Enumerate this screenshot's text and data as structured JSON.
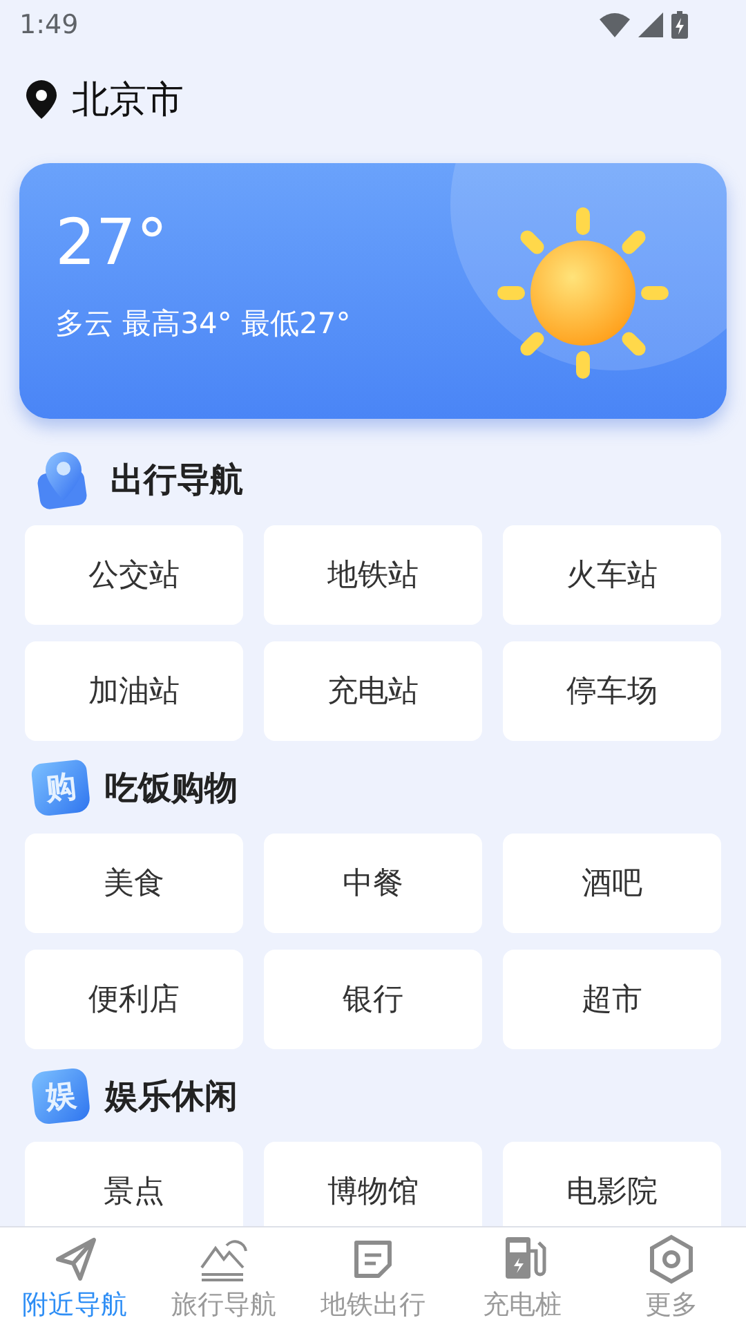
{
  "status_bar": {
    "time": "1:49"
  },
  "location": {
    "city": "北京市"
  },
  "weather": {
    "temperature": "27°",
    "summary": "多云 最高34° 最低27°"
  },
  "sections": [
    {
      "title": "出行导航",
      "items": [
        "公交站",
        "地铁站",
        "火车站",
        "加油站",
        "充电站",
        "停车场"
      ]
    },
    {
      "title": "吃饭购物",
      "icon_text": "购",
      "items": [
        "美食",
        "中餐",
        "酒吧",
        "便利店",
        "银行",
        "超市"
      ]
    },
    {
      "title": "娱乐休闲",
      "icon_text": "娱",
      "items": [
        "景点",
        "博物馆",
        "电影院"
      ]
    }
  ],
  "tab_bar": [
    {
      "label": "附近导航",
      "selected": true
    },
    {
      "label": "旅行导航",
      "selected": false
    },
    {
      "label": "地铁出行",
      "selected": false
    },
    {
      "label": "充电桩",
      "selected": false
    },
    {
      "label": "更多",
      "selected": false
    }
  ]
}
